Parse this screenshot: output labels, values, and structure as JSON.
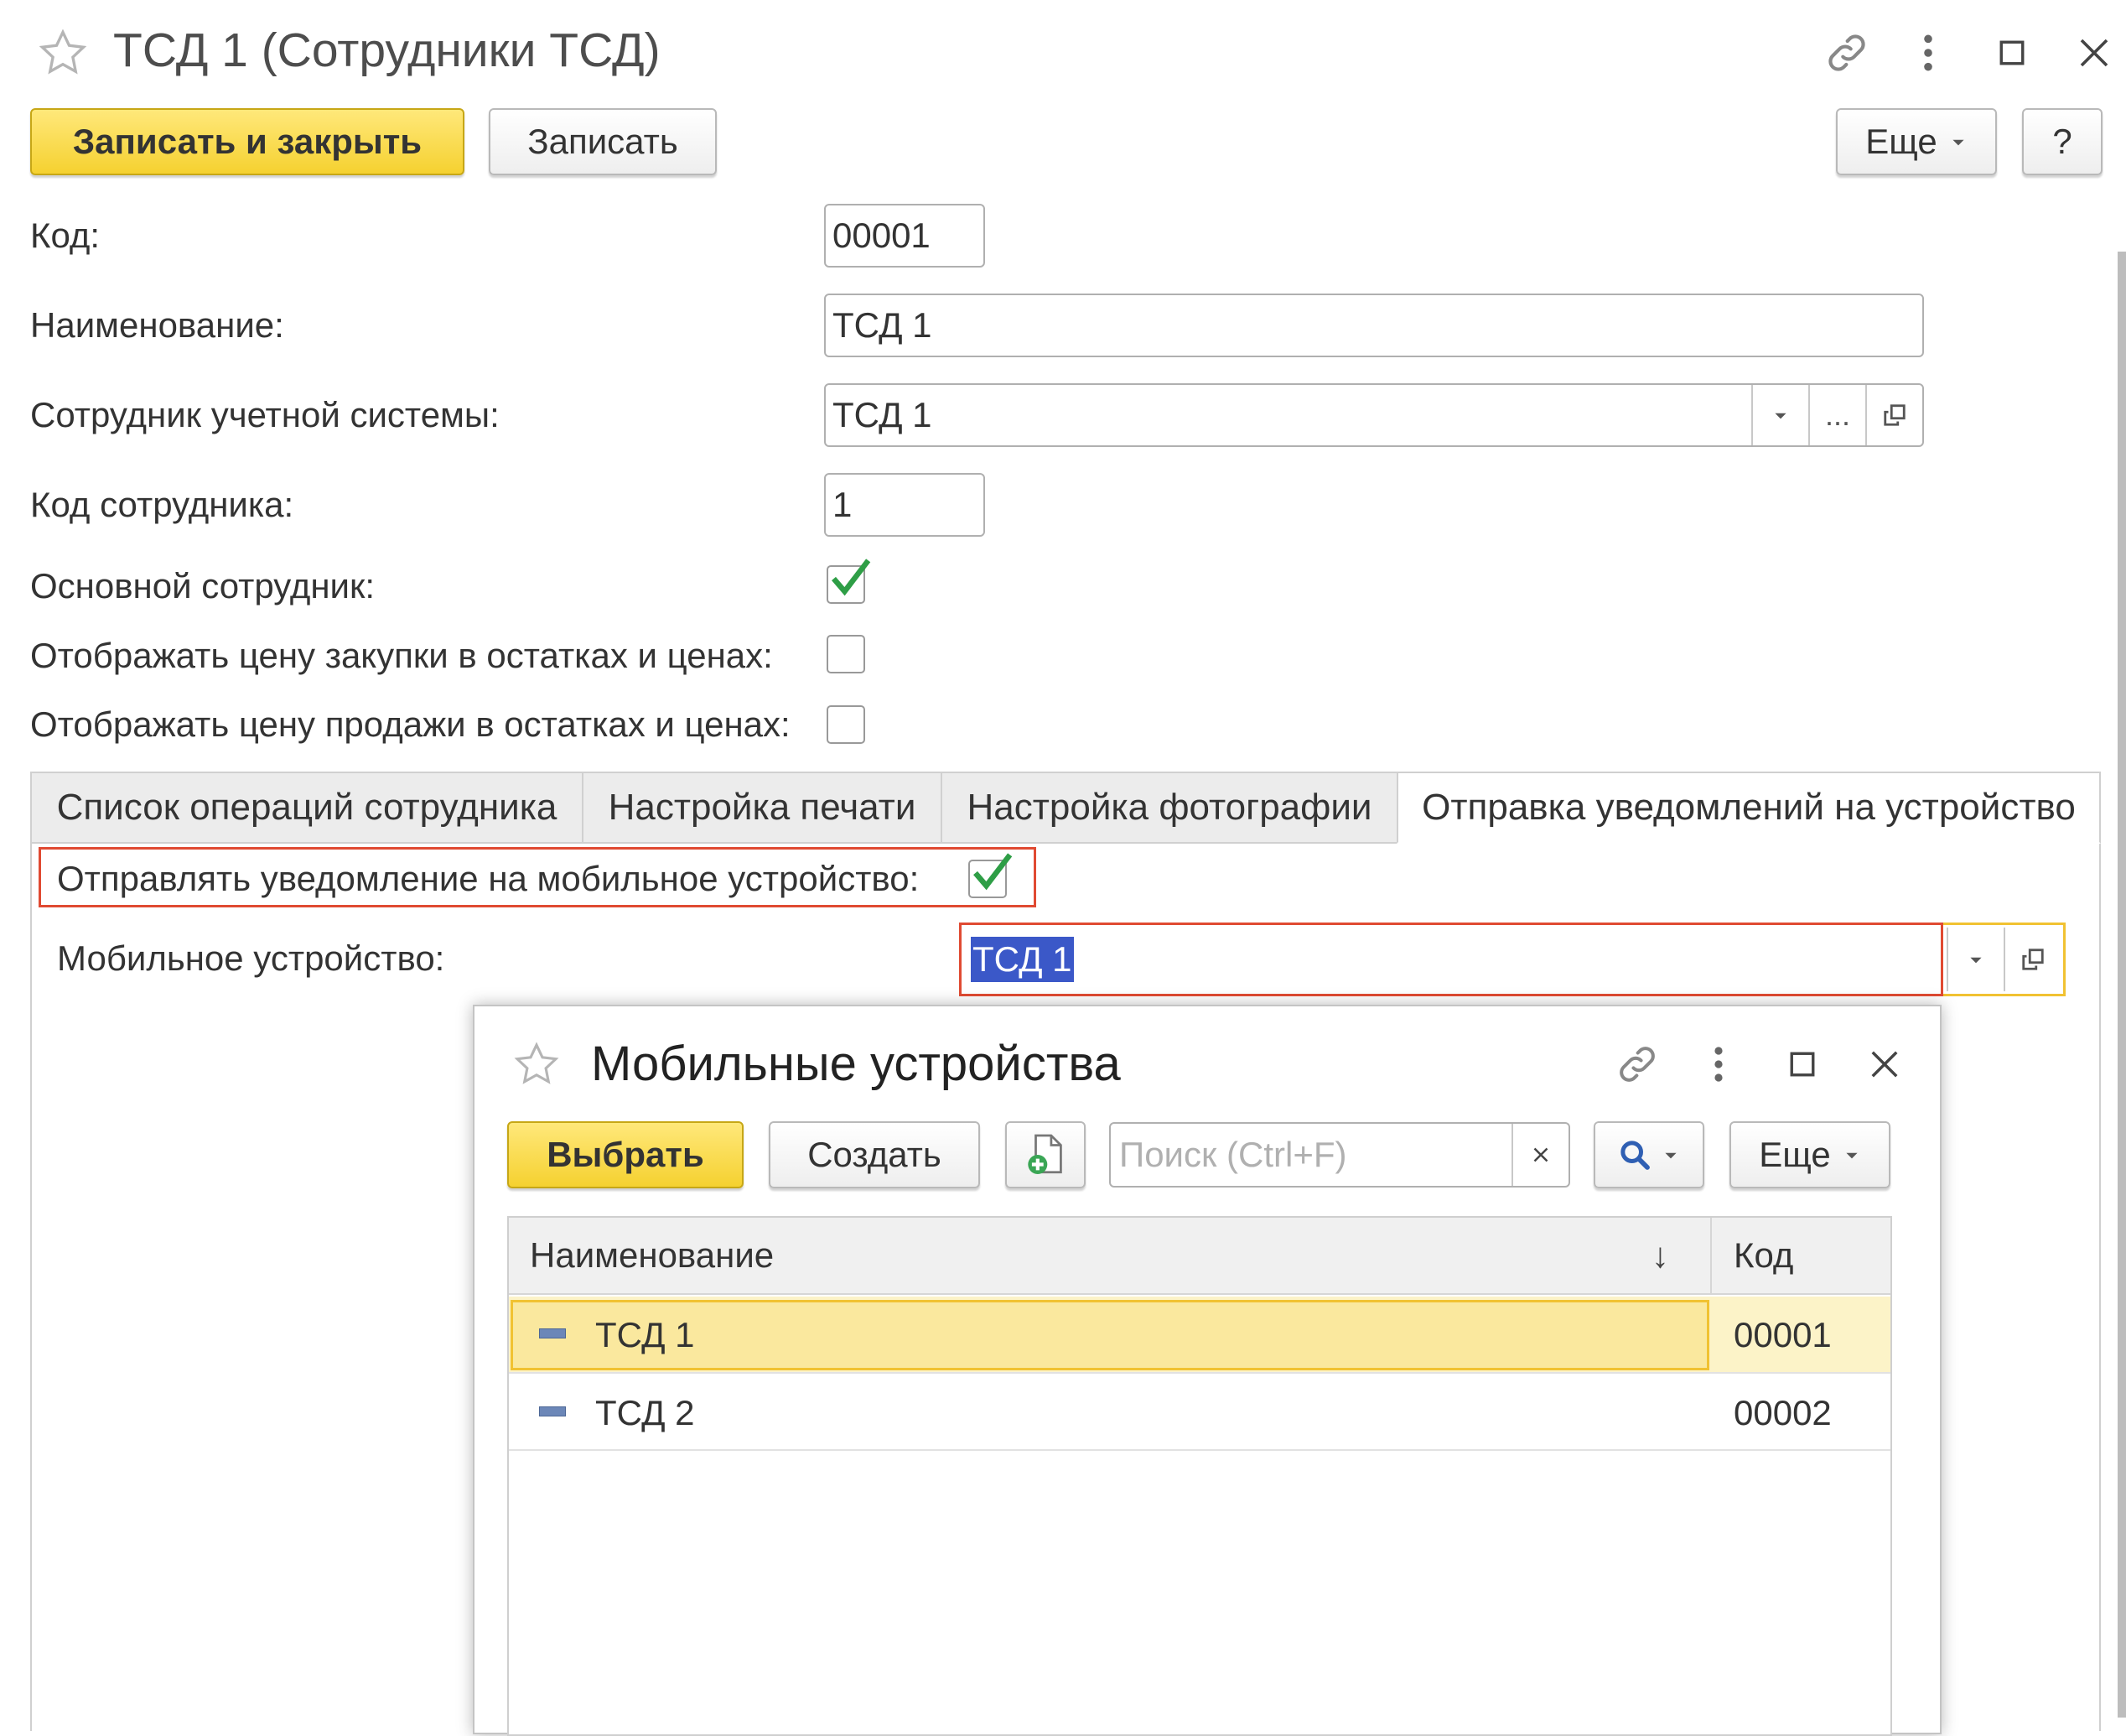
{
  "window": {
    "title": "ТСД 1 (Сотрудники ТСД)",
    "icons": [
      "star-icon",
      "link-icon",
      "more-icon",
      "maximize-icon",
      "close-icon"
    ]
  },
  "toolbar": {
    "save_close_label": "Записать и закрыть",
    "save_label": "Записать",
    "more_label": "Еще",
    "help_label": "?"
  },
  "form": {
    "code_label": "Код:",
    "code_value": "00001",
    "name_label": "Наименование:",
    "name_value": "ТСД 1",
    "employee_label": "Сотрудник учетной системы:",
    "employee_value": "ТСД 1",
    "ellipsis": "...",
    "employee_code_label": "Код сотрудника:",
    "employee_code_value": "1",
    "main_employee_label": "Основной сотрудник:",
    "main_employee_checked": true,
    "show_purchase_label": "Отображать цену закупки в остатках и ценах:",
    "show_purchase_checked": false,
    "show_sale_label": "Отображать цену продажи в остатках и ценах:",
    "show_sale_checked": false
  },
  "tabs": [
    {
      "label": "Список операций сотрудника",
      "active": false
    },
    {
      "label": "Настройка печати",
      "active": false
    },
    {
      "label": "Настройка фотографии",
      "active": false
    },
    {
      "label": "Отправка уведомлений на устройство",
      "active": true
    }
  ],
  "notifications": {
    "send_label": "Отправлять уведомление на мобильное устройство:",
    "send_checked": true,
    "device_label": "Мобильное устройство:",
    "device_value": "ТСД 1"
  },
  "popup": {
    "title": "Мобильные устройства",
    "select_label": "Выбрать",
    "create_label": "Создать",
    "search_placeholder": "Поиск (Ctrl+F)",
    "more_label": "Еще",
    "columns": {
      "name": "Наименование",
      "code": "Код",
      "sort_indicator": "↓"
    },
    "rows": [
      {
        "name": "ТСД 1",
        "code": "00001",
        "selected": true
      },
      {
        "name": "ТСД 2",
        "code": "00002",
        "selected": false
      }
    ]
  },
  "colors": {
    "primary_button": "#f5d130",
    "highlight_red": "#e04a32",
    "selected_row": "#fae89e",
    "checkmark": "#2e9e46",
    "text_selection": "#3b58c8"
  }
}
